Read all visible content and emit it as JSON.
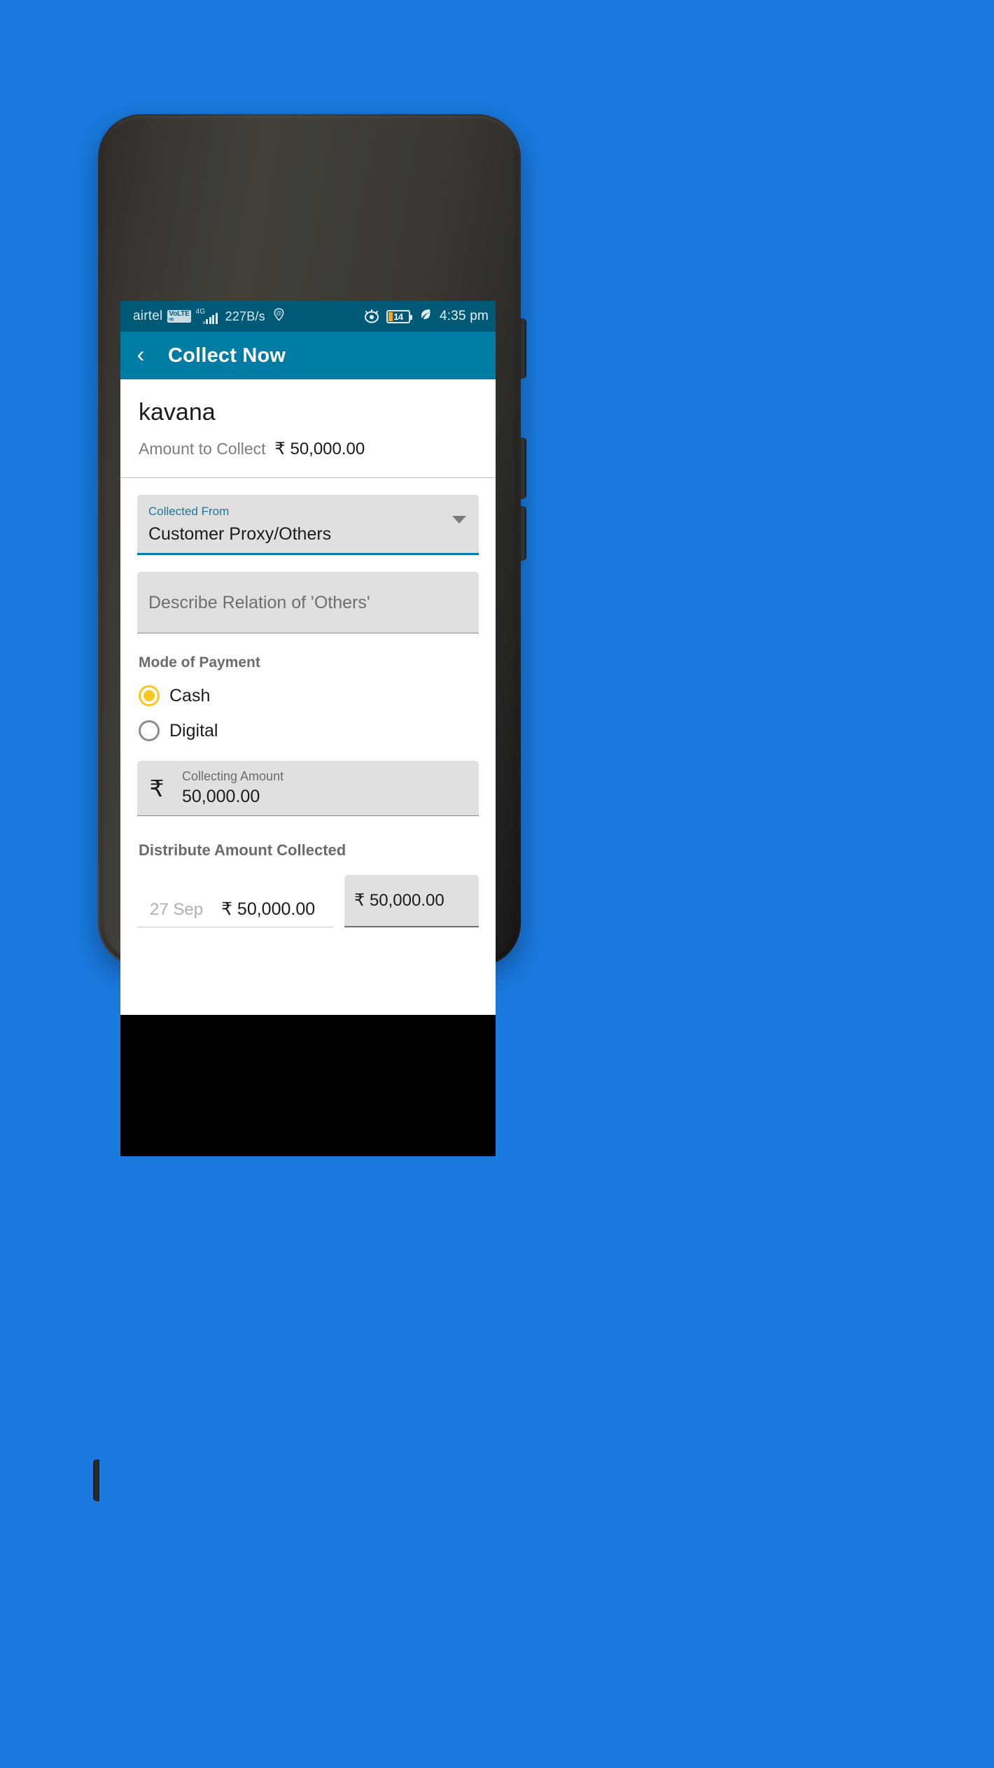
{
  "background_color": "#1a7ae0",
  "statusbar": {
    "carrier": "airtel",
    "volte": "VoLTE",
    "network": "4G",
    "data_speed": "227B/s",
    "location_icon": "location-pin-icon",
    "eye_icon": "eye-icon",
    "battery_percent": "14",
    "eco_icon": "leaf-icon",
    "time": "4:35 pm"
  },
  "appbar": {
    "back_icon": "back-chevron-icon",
    "title": "Collect Now"
  },
  "customer": {
    "name": "kavana",
    "amount_label": "Amount to Collect",
    "amount_value": "₹ 50,000.00"
  },
  "collected_from": {
    "label": "Collected From",
    "value": "Customer Proxy/Others",
    "caret_icon": "chevron-down-icon"
  },
  "relation": {
    "placeholder": "Describe Relation of 'Others'",
    "value": ""
  },
  "mode_of_payment": {
    "label": "Mode of Payment",
    "options": [
      {
        "label": "Cash",
        "selected": true
      },
      {
        "label": "Digital",
        "selected": false
      }
    ],
    "selected_color": "#fcc61c"
  },
  "collecting_amount": {
    "prefix": "₹",
    "label": "Collecting Amount",
    "value": "50,000.00"
  },
  "distribute": {
    "label": "Distribute Amount Collected",
    "row": {
      "date": "27 Sep",
      "amount": "₹ 50,000.00",
      "input_value": "₹ 50,000.00"
    }
  },
  "theme": {
    "appbar_color": "#017ca4",
    "statusbar_color": "#005977",
    "accent_color": "#1579a0",
    "field_bg": "#e0e0e0"
  }
}
